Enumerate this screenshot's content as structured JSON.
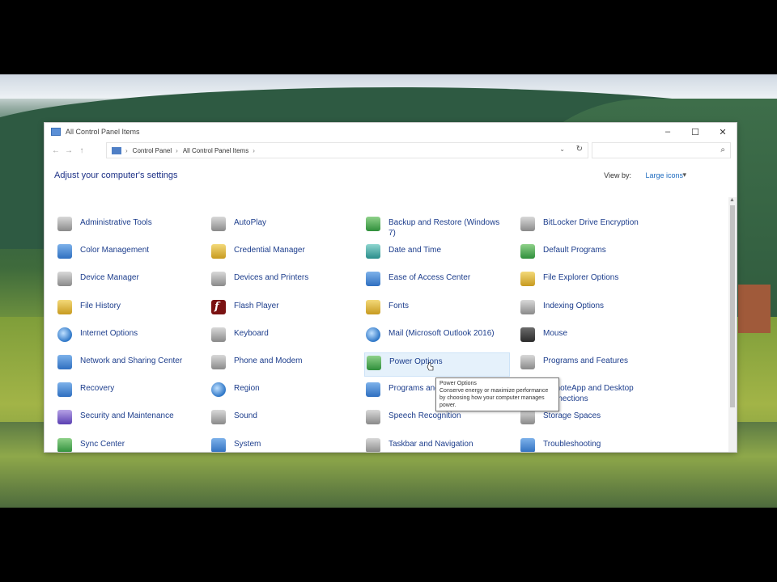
{
  "window": {
    "title": "All Control Panel Items",
    "controls": {
      "minimize": "–",
      "maximize": "☐",
      "close": "✕"
    }
  },
  "address": {
    "back": "←",
    "forward": "→",
    "up": "↑",
    "segments": [
      "Control Panel",
      "All Control Panel Items"
    ],
    "separator": "›",
    "dropdown": "⌄",
    "refresh": "↻",
    "search_placeholder": "",
    "search_icon": "⌕"
  },
  "header": {
    "heading": "Adjust your computer's settings",
    "view_by_label": "View by:",
    "view_by_value": "Large icons",
    "view_by_caret": "▾"
  },
  "items": [
    {
      "label": "Administrative Tools",
      "icon": "admin-tools-icon",
      "color": "grey"
    },
    {
      "label": "Color Management",
      "icon": "color-management-icon",
      "color": "blue"
    },
    {
      "label": "Device Manager",
      "icon": "device-manager-icon",
      "color": "grey"
    },
    {
      "label": "File History",
      "icon": "file-history-icon",
      "color": "gold"
    },
    {
      "label": "Internet Options",
      "icon": "internet-options-icon",
      "color": "globe"
    },
    {
      "label": "Network and Sharing Center",
      "icon": "network-icon",
      "color": "blue"
    },
    {
      "label": "Recovery",
      "icon": "recovery-icon",
      "color": "blue"
    },
    {
      "label": "Security and Maintenance",
      "icon": "security-flag-icon",
      "color": "purple"
    },
    {
      "label": "Sync Center",
      "icon": "sync-center-icon",
      "color": "green"
    },
    {
      "label": "AutoPlay",
      "icon": "autoplay-icon",
      "color": "grey"
    },
    {
      "label": "Credential Manager",
      "icon": "credential-manager-icon",
      "color": "gold"
    },
    {
      "label": "Devices and Printers",
      "icon": "printer-icon",
      "color": "grey"
    },
    {
      "label": "Flash Player",
      "icon": "flash-player-icon",
      "color": "red"
    },
    {
      "label": "Keyboard",
      "icon": "keyboard-icon",
      "color": "grey"
    },
    {
      "label": "Phone and Modem",
      "icon": "phone-modem-icon",
      "color": "grey"
    },
    {
      "label": "Region",
      "icon": "region-icon",
      "color": "globe"
    },
    {
      "label": "Sound",
      "icon": "sound-icon",
      "color": "grey"
    },
    {
      "label": "System",
      "icon": "system-icon",
      "color": "blue"
    },
    {
      "label": "Backup and Restore (Windows 7)",
      "icon": "backup-restore-icon",
      "color": "green"
    },
    {
      "label": "Date and Time",
      "icon": "date-time-icon",
      "color": "teal"
    },
    {
      "label": "Ease of Access Center",
      "icon": "ease-of-access-icon",
      "color": "blue"
    },
    {
      "label": "Fonts",
      "icon": "fonts-icon",
      "color": "gold"
    },
    {
      "label": "Mail (Microsoft Outlook 2016)",
      "icon": "mail-icon",
      "color": "globe"
    },
    {
      "label": "Power Options",
      "icon": "power-options-icon",
      "color": "green"
    },
    {
      "label": "Programs and Features",
      "icon": "registry-icon",
      "color": "blue"
    },
    {
      "label": "Speech Recognition",
      "icon": "microphone-icon",
      "color": "grey"
    },
    {
      "label": "Taskbar and Navigation",
      "icon": "taskbar-icon",
      "color": "grey"
    },
    {
      "label": "BitLocker Drive Encryption",
      "icon": "bitlocker-icon",
      "color": "grey"
    },
    {
      "label": "Default Programs",
      "icon": "default-programs-icon",
      "color": "green"
    },
    {
      "label": "File Explorer Options",
      "icon": "folder-options-icon",
      "color": "gold"
    },
    {
      "label": "Indexing Options",
      "icon": "indexing-options-icon",
      "color": "grey"
    },
    {
      "label": "Mouse",
      "icon": "mouse-icon",
      "color": "dark"
    },
    {
      "label": "Programs and Features",
      "icon": "programs-features-icon",
      "color": "grey"
    },
    {
      "label": "RemoteApp and Desktop Connections",
      "icon": "remoteapp-icon",
      "color": "blue"
    },
    {
      "label": "Storage Spaces",
      "icon": "storage-spaces-icon",
      "color": "grey"
    },
    {
      "label": "Troubleshooting",
      "icon": "troubleshooting-icon",
      "color": "blue"
    }
  ],
  "hovered_item_label": "Power Options",
  "tooltip": {
    "title": "Power Options",
    "text": "Conserve energy or maximize performance by choosing how your computer manages power."
  }
}
